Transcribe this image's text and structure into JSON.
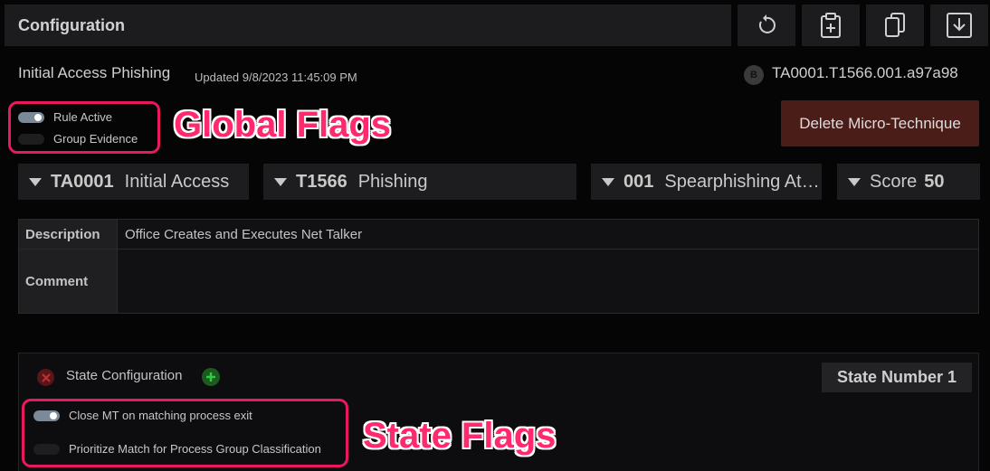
{
  "header": {
    "title": "Configuration",
    "tools": [
      {
        "name": "refresh-icon"
      },
      {
        "name": "clipboard-add-icon"
      },
      {
        "name": "copy-icon"
      },
      {
        "name": "download-icon"
      }
    ]
  },
  "rule": {
    "name": "Initial Access Phishing",
    "updated": "Updated 9/8/2023 11:45:09 PM",
    "badge": "B",
    "id": "TA0001.T1566.001.a97a98"
  },
  "global_flags": [
    {
      "label": "Rule Active",
      "enabled": true
    },
    {
      "label": "Group Evidence",
      "enabled": false
    }
  ],
  "delete_button": "Delete Micro-Technique",
  "dropdowns": [
    {
      "code": "TA0001",
      "name": "Initial Access"
    },
    {
      "code": "T1566",
      "name": "Phishing"
    },
    {
      "code": "001",
      "name": "Spearphishing Attachment"
    },
    {
      "label": "Score",
      "value": "50"
    }
  ],
  "fields": {
    "description_label": "Description",
    "description_value": "Office Creates and Executes Net Talker",
    "comment_label": "Comment",
    "comment_value": ""
  },
  "state": {
    "title": "State Configuration",
    "number_label": "State Number 1",
    "flags": [
      {
        "label": "Close MT on matching process exit",
        "enabled": true
      },
      {
        "label": "Prioritize Match for Process Group Classification",
        "enabled": false
      }
    ]
  },
  "annotations": {
    "global": "Global Flags",
    "state": "State Flags"
  },
  "colors": {
    "annotation": "#ff2a6d",
    "delete_button": "#4a1d18",
    "toggle_on": "#7a8a99",
    "remove_state": "#5a1518",
    "add_state": "#1c5a1f"
  }
}
